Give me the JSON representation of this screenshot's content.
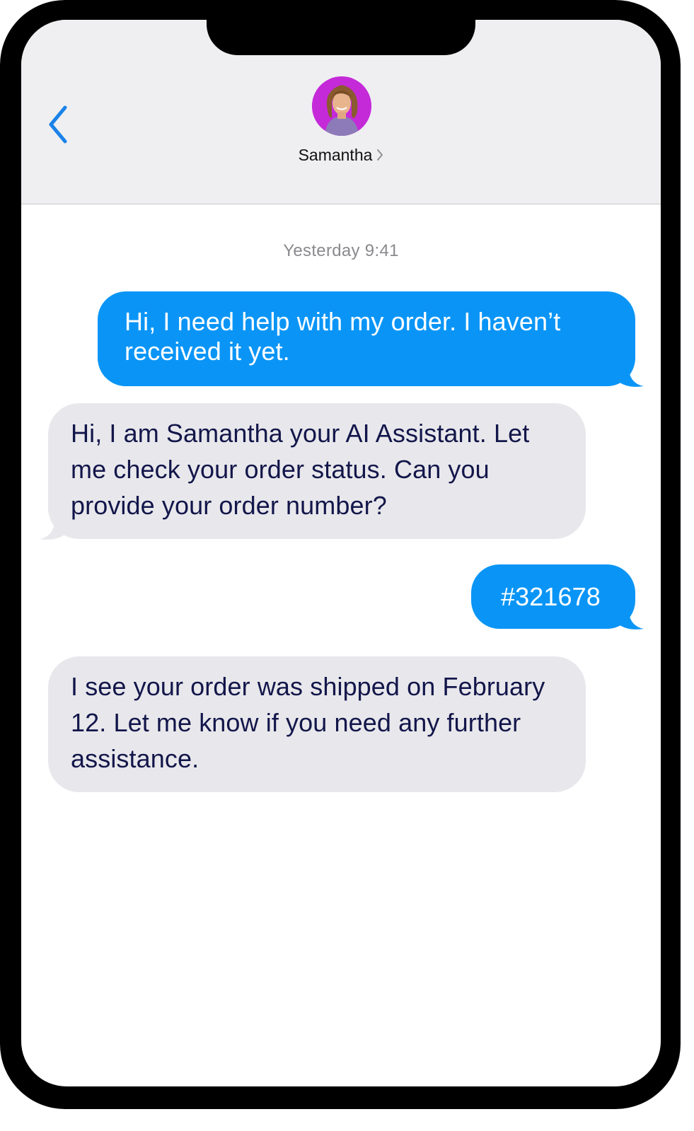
{
  "header": {
    "back_label": "back",
    "contact_name": "Samantha"
  },
  "conversation": {
    "timestamp": "Yesterday 9:41",
    "messages": [
      {
        "direction": "outgoing",
        "text": "Hi, I need help with my order. I haven’t received it yet."
      },
      {
        "direction": "incoming",
        "text": "Hi, I am Samantha your AI Assistant. Let me check your order status. Can you provide your order number?"
      },
      {
        "direction": "outgoing",
        "text": "#321678"
      },
      {
        "direction": "incoming",
        "text": "I see your order was shipped on February 12. Let me know if you need any further assistance."
      }
    ]
  },
  "colors": {
    "outgoing_bubble": "#0a95f6",
    "incoming_bubble": "#e8e8ec",
    "incoming_text": "#13164a",
    "accent": "#1a82e8",
    "avatar_ring": "#c52ad9"
  }
}
